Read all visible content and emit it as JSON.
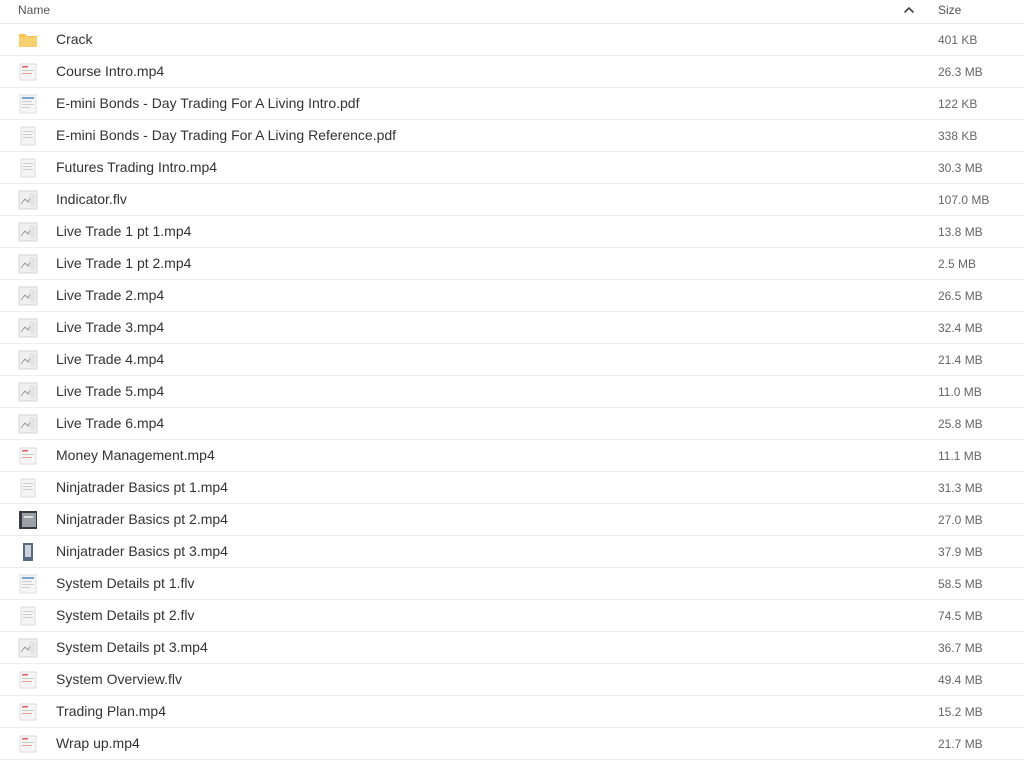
{
  "header": {
    "name_label": "Name",
    "size_label": "Size",
    "sort_icon": "chevron-up-icon"
  },
  "colors": {
    "folder": "#f5c252",
    "divider": "#ececec",
    "text": "#333333",
    "muted": "#666666"
  },
  "files": [
    {
      "name": "Crack",
      "size": "401 KB",
      "kind": "folder"
    },
    {
      "name": "Course Intro.mp4",
      "size": "26.3 MB",
      "kind": "doc-red"
    },
    {
      "name": "E-mini Bonds - Day Trading For A Living Intro.pdf",
      "size": "122 KB",
      "kind": "doc-blue"
    },
    {
      "name": "E-mini Bonds - Day Trading For A Living Reference.pdf",
      "size": "338 KB",
      "kind": "doc"
    },
    {
      "name": "Futures Trading Intro.mp4",
      "size": "30.3 MB",
      "kind": "doc"
    },
    {
      "name": "Indicator.flv",
      "size": "107.0 MB",
      "kind": "chart"
    },
    {
      "name": "Live Trade 1 pt 1.mp4",
      "size": "13.8 MB",
      "kind": "chart"
    },
    {
      "name": "Live Trade 1 pt 2.mp4",
      "size": "2.5 MB",
      "kind": "chart"
    },
    {
      "name": "Live Trade 2.mp4",
      "size": "26.5 MB",
      "kind": "chart"
    },
    {
      "name": "Live Trade 3.mp4",
      "size": "32.4 MB",
      "kind": "chart"
    },
    {
      "name": "Live Trade 4.mp4",
      "size": "21.4 MB",
      "kind": "chart"
    },
    {
      "name": "Live Trade 5.mp4",
      "size": "11.0 MB",
      "kind": "chart"
    },
    {
      "name": "Live Trade 6.mp4",
      "size": "25.8 MB",
      "kind": "chart"
    },
    {
      "name": "Money Management.mp4",
      "size": "11.1 MB",
      "kind": "doc-red"
    },
    {
      "name": "Ninjatrader Basics pt 1.mp4",
      "size": "31.3 MB",
      "kind": "doc"
    },
    {
      "name": "Ninjatrader Basics pt 2.mp4",
      "size": "27.0 MB",
      "kind": "dark"
    },
    {
      "name": "Ninjatrader Basics pt 3.mp4",
      "size": "37.9 MB",
      "kind": "window"
    },
    {
      "name": "System Details pt 1.flv",
      "size": "58.5 MB",
      "kind": "doc-blue"
    },
    {
      "name": "System Details pt 2.flv",
      "size": "74.5 MB",
      "kind": "doc"
    },
    {
      "name": "System Details pt 3.mp4",
      "size": "36.7 MB",
      "kind": "chart"
    },
    {
      "name": "System Overview.flv",
      "size": "49.4 MB",
      "kind": "doc-red"
    },
    {
      "name": "Trading Plan.mp4",
      "size": "15.2 MB",
      "kind": "doc-red"
    },
    {
      "name": "Wrap up.mp4",
      "size": "21.7 MB",
      "kind": "doc-red"
    }
  ]
}
